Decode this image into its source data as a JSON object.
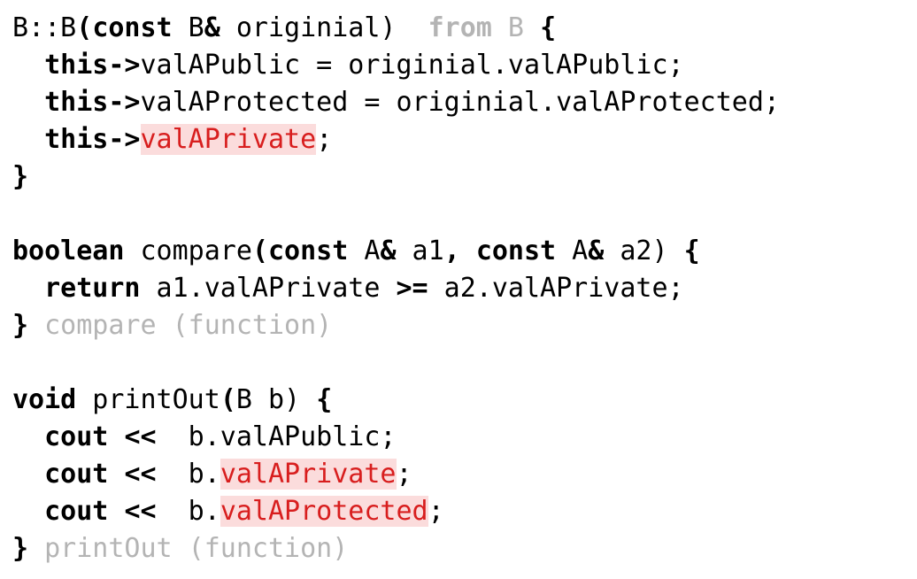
{
  "code": {
    "lines": [
      [
        {
          "t": "B::B",
          "c": "n"
        },
        {
          "t": "(",
          "c": "kw"
        },
        {
          "t": "const",
          "c": "kw"
        },
        {
          "t": " B",
          "c": "n"
        },
        {
          "t": "&",
          "c": "kw"
        },
        {
          "t": " originial)  ",
          "c": "n"
        },
        {
          "t": "from",
          "c": "dimkw"
        },
        {
          "t": " B ",
          "c": "dim"
        },
        {
          "t": "{",
          "c": "kw"
        }
      ],
      [
        {
          "t": "  ",
          "c": "n"
        },
        {
          "t": "this->",
          "c": "kw"
        },
        {
          "t": "valAPublic = originial.valAPublic;",
          "c": "n"
        }
      ],
      [
        {
          "t": "  ",
          "c": "n"
        },
        {
          "t": "this->",
          "c": "kw"
        },
        {
          "t": "valAProtected = originial.valAProtected;",
          "c": "n"
        }
      ],
      [
        {
          "t": "  ",
          "c": "n"
        },
        {
          "t": "this->",
          "c": "kw"
        },
        {
          "t": "valAPrivate",
          "c": "err"
        },
        {
          "t": ";",
          "c": "n"
        }
      ],
      [
        {
          "t": "}",
          "c": "kw"
        }
      ],
      [],
      [
        {
          "t": "boolean",
          "c": "kw"
        },
        {
          "t": " compare",
          "c": "n"
        },
        {
          "t": "(",
          "c": "kw"
        },
        {
          "t": "const",
          "c": "kw"
        },
        {
          "t": " A",
          "c": "n"
        },
        {
          "t": "&",
          "c": "kw"
        },
        {
          "t": " a1",
          "c": "n"
        },
        {
          "t": ",",
          "c": "kw"
        },
        {
          "t": " ",
          "c": "n"
        },
        {
          "t": "const",
          "c": "kw"
        },
        {
          "t": " A",
          "c": "n"
        },
        {
          "t": "&",
          "c": "kw"
        },
        {
          "t": " a2) ",
          "c": "n"
        },
        {
          "t": "{",
          "c": "kw"
        }
      ],
      [
        {
          "t": "  ",
          "c": "n"
        },
        {
          "t": "return",
          "c": "kw"
        },
        {
          "t": " a1.valAPrivate ",
          "c": "n"
        },
        {
          "t": ">=",
          "c": "kw"
        },
        {
          "t": " a2.valAPrivate;",
          "c": "n"
        }
      ],
      [
        {
          "t": "}",
          "c": "kw"
        },
        {
          "t": " compare (function)",
          "c": "dim"
        }
      ],
      [],
      [
        {
          "t": "void",
          "c": "kw"
        },
        {
          "t": " printOut",
          "c": "n"
        },
        {
          "t": "(",
          "c": "kw"
        },
        {
          "t": "B b) ",
          "c": "n"
        },
        {
          "t": "{",
          "c": "kw"
        }
      ],
      [
        {
          "t": "  ",
          "c": "n"
        },
        {
          "t": "cout",
          "c": "kw"
        },
        {
          "t": " ",
          "c": "n"
        },
        {
          "t": "<<",
          "c": "kw"
        },
        {
          "t": "  b.valAPublic;",
          "c": "n"
        }
      ],
      [
        {
          "t": "  ",
          "c": "n"
        },
        {
          "t": "cout",
          "c": "kw"
        },
        {
          "t": " ",
          "c": "n"
        },
        {
          "t": "<<",
          "c": "kw"
        },
        {
          "t": "  b.",
          "c": "n"
        },
        {
          "t": "valAPrivate",
          "c": "err"
        },
        {
          "t": ";",
          "c": "n"
        }
      ],
      [
        {
          "t": "  ",
          "c": "n"
        },
        {
          "t": "cout",
          "c": "kw"
        },
        {
          "t": " ",
          "c": "n"
        },
        {
          "t": "<<",
          "c": "kw"
        },
        {
          "t": "  b.",
          "c": "n"
        },
        {
          "t": "valAProtected",
          "c": "err"
        },
        {
          "t": ";",
          "c": "n"
        }
      ],
      [
        {
          "t": "}",
          "c": "kw"
        },
        {
          "t": " printOut (function)",
          "c": "dim"
        }
      ]
    ]
  },
  "colors": {
    "text": "#000000",
    "annotation": "#b4b4b4",
    "error_text": "#d81e1e",
    "error_background": "#fbdcdc"
  }
}
